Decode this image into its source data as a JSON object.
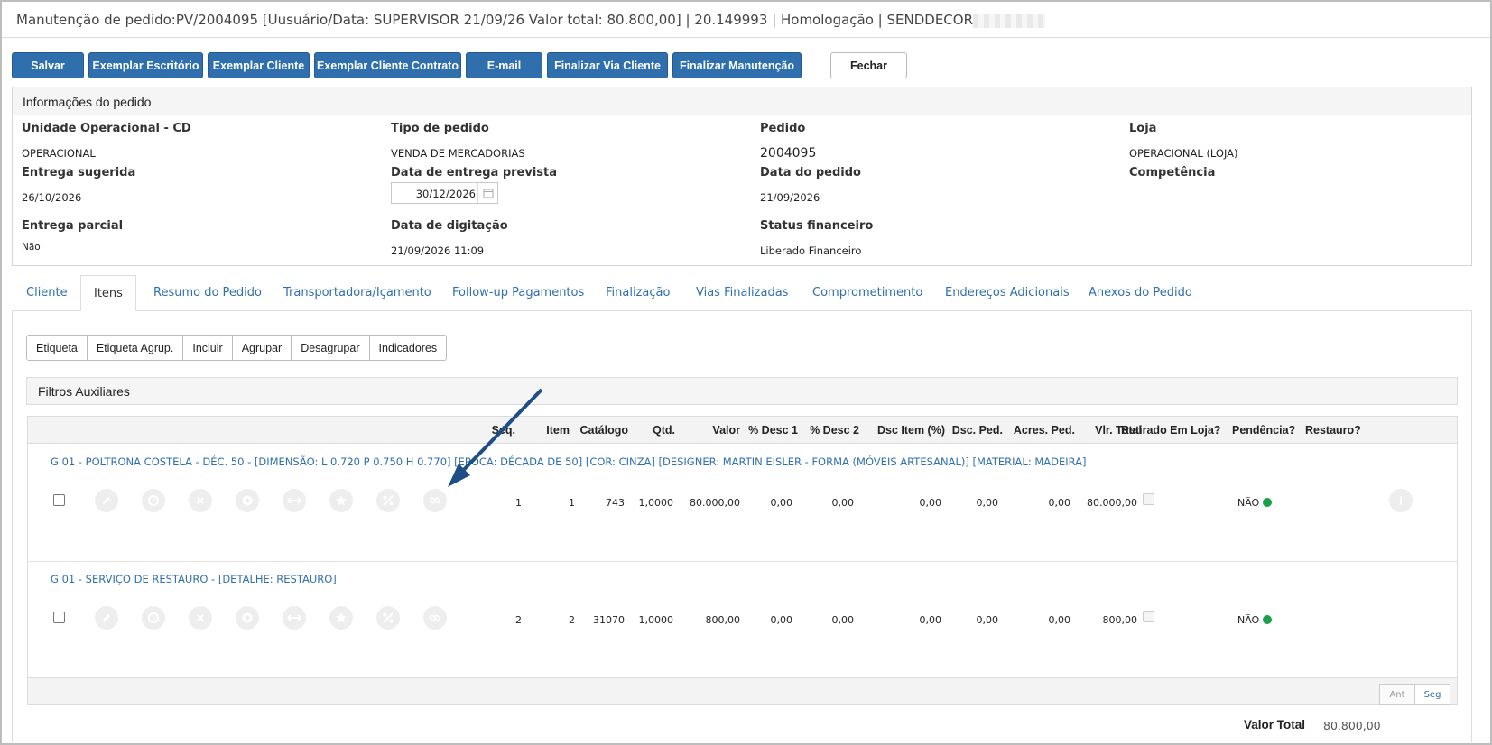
{
  "window": {
    "title": "Manutenção de pedido:PV/2004095 [Uusuário/Data: SUPERVISOR 21/09/26 Valor total: 80.800,00] | 20.149993 | Homologação | SENDDECOR"
  },
  "toolbar": {
    "salvar": "Salvar",
    "exemplar_escritorio": "Exemplar Escritório",
    "exemplar_cliente": "Exemplar Cliente",
    "exemplar_cliente_contrato": "Exemplar Cliente Contrato",
    "email": "E-mail",
    "finalizar_via_cliente": "Finalizar Via Cliente",
    "finalizar_manutencao": "Finalizar Manutenção",
    "fechar": "Fechar"
  },
  "info": {
    "header": "Informações do pedido",
    "unidade_label": "Unidade Operacional - CD",
    "unidade_value": "OPERACIONAL",
    "tipo_label": "Tipo de pedido",
    "tipo_value": "VENDA DE MERCADORIAS",
    "pedido_label": "Pedido",
    "pedido_value": "2004095",
    "loja_label": "Loja",
    "loja_value": "OPERACIONAL (LOJA)",
    "entrega_sugerida_label": "Entrega sugerida",
    "entrega_sugerida_value": "26/10/2026",
    "entrega_prevista_label": "Data de entrega prevista",
    "entrega_prevista_value": "30/12/2026",
    "data_pedido_label": "Data do pedido",
    "data_pedido_value": "21/09/2026",
    "competencia_label": "Competência",
    "entrega_parcial_label": "Entrega parcial",
    "entrega_parcial_value": "Não",
    "digitacao_label": "Data de digitação",
    "digitacao_value": "21/09/2026 11:09",
    "status_fin_label": "Status financeiro",
    "status_fin_value": "Liberado Financeiro"
  },
  "tabs": {
    "cliente": "Cliente",
    "itens": "Itens",
    "resumo": "Resumo do Pedido",
    "transportadora": "Transportadora/Içamento",
    "followup": "Follow-up Pagamentos",
    "finalizacao": "Finalização",
    "vias": "Vias Finalizadas",
    "comprometimento": "Comprometimento",
    "enderecos": "Endereços Adicionais",
    "anexos": "Anexos do Pedido"
  },
  "item_actions": {
    "etiqueta": "Etiqueta",
    "etiqueta_agrup": "Etiqueta Agrup.",
    "incluir": "Incluir",
    "agrupar": "Agrupar",
    "desagrupar": "Desagrupar",
    "indicadores": "Indicadores"
  },
  "filters": {
    "header": "Filtros Auxiliares"
  },
  "grid": {
    "columns": {
      "seq": "Seq.",
      "item": "Item",
      "catalogo": "Catálogo",
      "qtd": "Qtd.",
      "valor": "Valor",
      "desc1": "% Desc 1",
      "desc2": "% Desc 2",
      "dsc_item": "Dsc Item (%)",
      "dsc_ped": "Dsc. Ped.",
      "acres_ped": "Acres. Ped.",
      "vlr_total": "Vlr. Total",
      "retirado": "Retirado Em Loja?",
      "pendencia": "Pendência?",
      "restauro": "Restauro?"
    },
    "rows": [
      {
        "title": "G 01 - POLTRONA COSTELA - DÉC. 50 - [DIMENSÃO: L 0.720 P 0.750 H 0.770] [EPOCA: DÉCADA DE 50] [COR: CINZA] [DESIGNER: MARTIN EISLER - FORMA (MÓVEIS ARTESANAL)] [MATERIAL: MADEIRA]",
        "seq": "1",
        "item": "1",
        "catalogo": "743",
        "qtd": "1,0000",
        "valor": "80.000,00",
        "desc1": "0,00",
        "desc2": "0,00",
        "dsc_item": "0,00",
        "dsc_ped": "0,00",
        "acres_ped": "0,00",
        "vlr_total": "80.000,00",
        "pendencia": "NÃO"
      },
      {
        "title": "G 01 - SERVIÇO DE RESTAURO - [DETALHE: RESTAURO]",
        "seq": "2",
        "item": "2",
        "catalogo": "31070",
        "qtd": "1,0000",
        "valor": "800,00",
        "desc1": "0,00",
        "desc2": "0,00",
        "dsc_item": "0,00",
        "dsc_ped": "0,00",
        "acres_ped": "0,00",
        "vlr_total": "800,00",
        "pendencia": "NÃO"
      }
    ],
    "row_icons": [
      "edit-icon",
      "history-icon",
      "remove-icon",
      "settings-icon",
      "swap-icon",
      "star-icon",
      "discount-icon",
      "link-icon"
    ],
    "pager": {
      "prev": "Ant",
      "next": "Seg"
    }
  },
  "total": {
    "label": "Valor Total",
    "value": "80.800,00"
  },
  "colors": {
    "primary": "#2f6fad",
    "status_ok": "#1a9f4b",
    "annotation_arrow": "#1f4e86"
  }
}
